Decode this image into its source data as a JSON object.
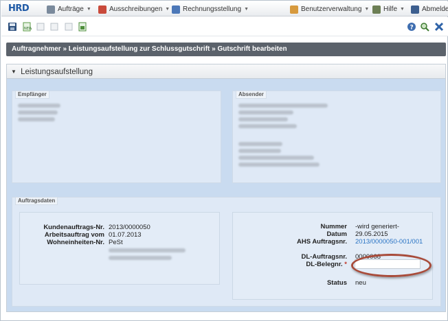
{
  "nav": {
    "logo": "HRD",
    "items": [
      {
        "label": "Aufträge",
        "icon": "orders-icon"
      },
      {
        "label": "Ausschreibungen",
        "icon": "tenders-icon"
      },
      {
        "label": "Rechnungsstellung",
        "icon": "invoicing-icon"
      }
    ],
    "right": [
      {
        "label": "Benutzerverwaltung",
        "icon": "users-icon"
      },
      {
        "label": "Hilfe",
        "icon": "help-book-icon"
      },
      {
        "label": "Abmelden",
        "icon": "logout-icon"
      }
    ]
  },
  "toolbar": {
    "left_icons": [
      "save-icon",
      "new-icon",
      "copy-icon",
      "print-icon",
      "export-icon",
      "excel-icon"
    ],
    "right_icons": [
      "help-icon",
      "search-icon",
      "close-icon"
    ]
  },
  "breadcrumb": "Auftragnehmer » Leistungsaufstellung zur Schlussgutschrift » Gutschrift bearbeiten",
  "panel": {
    "title": "Leistungsaufstellung"
  },
  "empfaenger": {
    "label": "Empfänger"
  },
  "absender": {
    "label": "Absender"
  },
  "auftragsdaten": {
    "label": "Auftragsdaten",
    "left": {
      "kundenauftrags_label": "Kundenauftrags-Nr.",
      "kundenauftrags_value": "2013/0000050",
      "arbeitsauftrag_label": "Arbeitsauftrag vom",
      "arbeitsauftrag_value": "01.07.2013",
      "wohneinheiten_label": "Wohneinheiten-Nr.",
      "wohneinheiten_value": "PeSt"
    },
    "right": {
      "nummer_label": "Nummer",
      "nummer_value": "-wird generiert-",
      "datum_label": "Datum",
      "datum_value": "29.05.2015",
      "ahs_label": "AHS Auftragsnr.",
      "ahs_value": "2013/0000050-001/001",
      "dl_auftrag_label": "DL-Auftragsnr.",
      "dl_auftrag_value": "0000068",
      "dl_beleg_label": "DL-Belegnr.",
      "required_mark": "*",
      "dl_beleg_value": "",
      "status_label": "Status",
      "status_value": "neu"
    }
  },
  "colors": {
    "breadcrumb_bg": "#5b626b",
    "panel_bg": "#c9dbf0",
    "link": "#2a74c4",
    "highlight_ellipse": "#a84b3a"
  }
}
